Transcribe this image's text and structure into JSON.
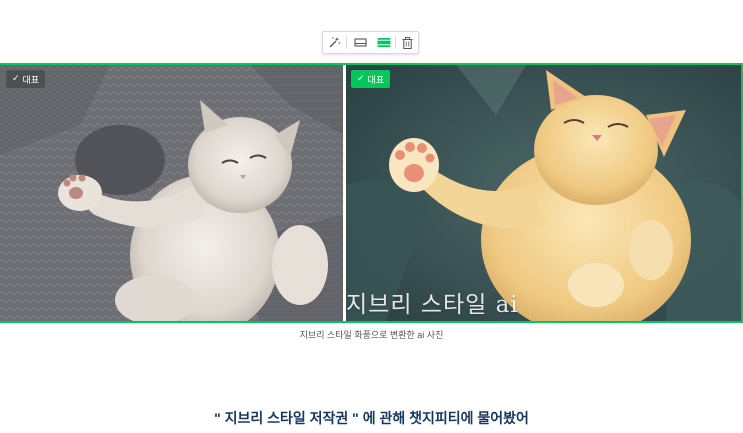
{
  "toolbar": {
    "tools": [
      {
        "icon": "magic-wand-icon"
      },
      {
        "icon": "layout-original-icon"
      },
      {
        "icon": "layout-full-width-icon",
        "active": true
      },
      {
        "icon": "trash-icon"
      }
    ],
    "active_color": "#03c75a"
  },
  "gallery": {
    "border_color": "#03c75a",
    "photos": [
      {
        "badge": "대표",
        "description": "real kitten photo",
        "badge_style": "inactive"
      },
      {
        "badge": "대표",
        "description": "ghibli style kitten",
        "badge_style": "active",
        "overlay_text": "지브리 스타일 ai"
      }
    ]
  },
  "caption": "지브리 스타일 화풍으로 변환한 ai 사진",
  "heading": "\" 지브리 스타일 저작권 \" 에 관해 챗지피티에 물어봤어"
}
